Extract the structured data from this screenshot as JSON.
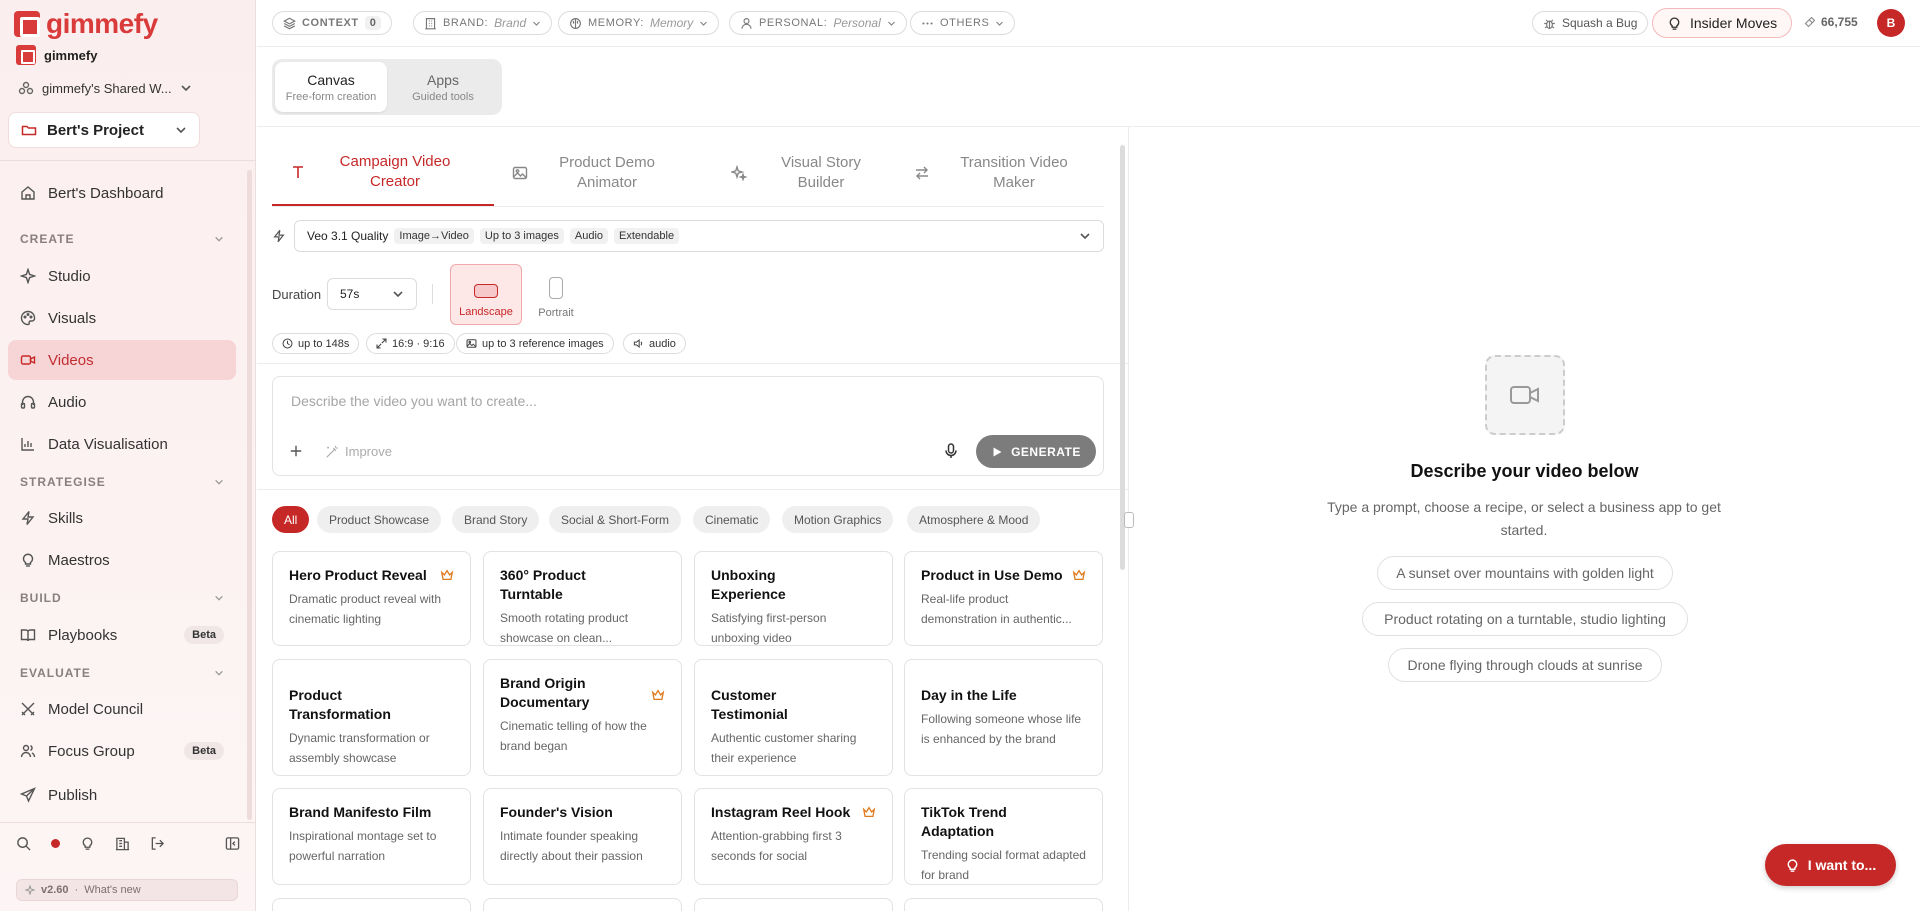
{
  "brand": {
    "logo_text": "gimmefy",
    "org_name": "gimmefy"
  },
  "workspace": {
    "name": "gimmefy's Shared W..."
  },
  "project": {
    "name": "Bert's Project"
  },
  "sidebar": {
    "dashboard": "Bert's Dashboard",
    "sections": [
      {
        "title": "CREATE",
        "items": [
          "Studio",
          "Visuals",
          "Videos",
          "Audio",
          "Data Visualisation"
        ]
      },
      {
        "title": "STRATEGISE",
        "items": [
          "Skills",
          "Maestros"
        ]
      },
      {
        "title": "BUILD",
        "items": [
          "Playbooks"
        ]
      },
      {
        "title": "EVALUATE",
        "items": [
          "Model Council",
          "Focus Group",
          "Publish"
        ]
      }
    ],
    "beta_label": "Beta",
    "active_item": "Videos",
    "version": "v2.60",
    "whats_new": "What's new"
  },
  "topbar": {
    "context_label": "CONTEXT",
    "context_count": "0",
    "brand_label": "BRAND:",
    "brand_value": "Brand",
    "memory_label": "MEMORY:",
    "memory_value": "Memory",
    "personal_label": "PERSONAL:",
    "personal_value": "Personal",
    "others_label": "OTHERS",
    "bug_label": "Squash a Bug",
    "insider_label": "Insider Moves",
    "credits": "66,755",
    "avatar_initial": "B"
  },
  "mode": {
    "canvas_title": "Canvas",
    "canvas_sub": "Free-form creation",
    "apps_title": "Apps",
    "apps_sub": "Guided tools"
  },
  "tabs": [
    {
      "label": "Campaign Video Creator",
      "active": true
    },
    {
      "label": "Product Demo Animator",
      "active": false
    },
    {
      "label": "Visual Story Builder",
      "active": false
    },
    {
      "label": "Transition Video Maker",
      "active": false
    }
  ],
  "model": {
    "name": "Veo 3.1 Quality",
    "tags": [
      "Image→Video",
      "Up to 3 images",
      "Audio",
      "Extendable"
    ]
  },
  "duration": {
    "label": "Duration",
    "value": "57s"
  },
  "orientation": {
    "landscape": "Landscape",
    "portrait": "Portrait",
    "selected": "Landscape"
  },
  "chips": [
    "up to 148s",
    "16:9 · 9:16",
    "up to 3 reference images",
    "audio"
  ],
  "prompt": {
    "placeholder": "Describe the video you want to create...",
    "improve_label": "Improve",
    "generate_label": "GENERATE"
  },
  "filters": [
    "All",
    "Product Showcase",
    "Brand Story",
    "Social & Short-Form",
    "Cinematic",
    "Motion Graphics",
    "Atmosphere & Mood"
  ],
  "active_filter": "All",
  "recipes": [
    {
      "title": "Hero Product Reveal",
      "desc": "Dramatic product reveal with cinematic lighting",
      "premium": true
    },
    {
      "title": "360° Product Turntable",
      "desc": "Smooth rotating product showcase on clean...",
      "premium": false
    },
    {
      "title": "Unboxing Experience",
      "desc": "Satisfying first-person unboxing video",
      "premium": false
    },
    {
      "title": "Product in Use Demo",
      "desc": "Real-life product demonstration in authentic...",
      "premium": true
    },
    {
      "title": "Product Transformation",
      "desc": "Dynamic transformation or assembly showcase",
      "premium": false
    },
    {
      "title": "Brand Origin Documentary",
      "desc": "Cinematic telling of how the brand began",
      "premium": true
    },
    {
      "title": "Customer Testimonial",
      "desc": "Authentic customer sharing their experience",
      "premium": false
    },
    {
      "title": "Day in the Life",
      "desc": "Following someone whose life is enhanced by the brand",
      "premium": false
    },
    {
      "title": "Brand Manifesto Film",
      "desc": "Inspirational montage set to powerful narration",
      "premium": false
    },
    {
      "title": "Founder's Vision",
      "desc": "Intimate founder speaking directly about their passion",
      "premium": false
    },
    {
      "title": "Instagram Reel Hook",
      "desc": "Attention-grabbing first 3 seconds for social",
      "premium": true
    },
    {
      "title": "TikTok Trend Adaptation",
      "desc": "Trending social format adapted for brand",
      "premium": false
    }
  ],
  "right_panel": {
    "title": "Describe your video below",
    "subtitle": "Type a prompt, choose a recipe, or select a business app to get started.",
    "suggestions": [
      "A sunset over mountains with golden light",
      "Product rotating on a turntable, studio lighting",
      "Drone flying through clouds at sunrise"
    ]
  },
  "fab": {
    "label": "I want to..."
  },
  "colors": {
    "accent": "#c62828",
    "sidebar_bg": "#fbeeee",
    "active_bg": "#f7d5d6"
  }
}
